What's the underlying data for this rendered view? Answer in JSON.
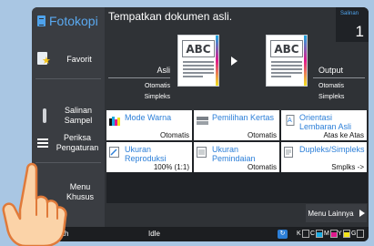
{
  "app": {
    "title": "Fotokopi",
    "prompt": "Tempatkan dokumen asli."
  },
  "copies": {
    "label": "Salinan",
    "value": "1"
  },
  "sidebar": {
    "favorite": "Favorit",
    "sample_copy": [
      "Salinan",
      "Sampel"
    ],
    "preview": [
      "Periksa",
      "Pengaturan"
    ],
    "special_menu": [
      "Menu",
      "Khusus"
    ]
  },
  "original": {
    "label": "Asli",
    "mode": "Otomatis",
    "side": "Simpleks"
  },
  "output": {
    "label": "Output",
    "mode": "Otomatis",
    "side": "Simpleks"
  },
  "preview_doc": {
    "text": "ABC"
  },
  "tiles": [
    {
      "label": "Mode Warna",
      "value": "Otomatis",
      "icon": "color-mode-icon"
    },
    {
      "label": "Pemilihan Kertas",
      "value": "Otomatis",
      "icon": "paper-select-icon"
    },
    {
      "label": "Orientasi Lembaran Asli",
      "value": "Atas ke Atas",
      "icon": "orientation-icon"
    },
    {
      "label": "Ukuran Reproduksi",
      "value": "100% (1:1)",
      "icon": "reproduction-size-icon"
    },
    {
      "label": "Ukuran Pemindaian",
      "value": "Otomatis",
      "icon": "scan-size-icon"
    },
    {
      "label": "Dupleks/Simpleks",
      "value": "Smplks ->",
      "icon": "duplex-icon"
    }
  ],
  "more_menu": "Menu Lainnya",
  "status": {
    "user": "Smith",
    "state": "Idle",
    "toner": [
      {
        "label": "K",
        "color": "#111111",
        "level": 0.0
      },
      {
        "label": "C",
        "color": "#18a8e0",
        "level": 0.7
      },
      {
        "label": "M",
        "color": "#e0188c",
        "level": 0.7
      },
      {
        "label": "Y",
        "color": "#f2e21b",
        "level": 0.7
      },
      {
        "label": "G",
        "color": "#888888",
        "level": 0.0
      }
    ]
  },
  "colors": {
    "accent": "#4fa3ec",
    "background": "#2f3236",
    "tile": "#ffffff"
  }
}
